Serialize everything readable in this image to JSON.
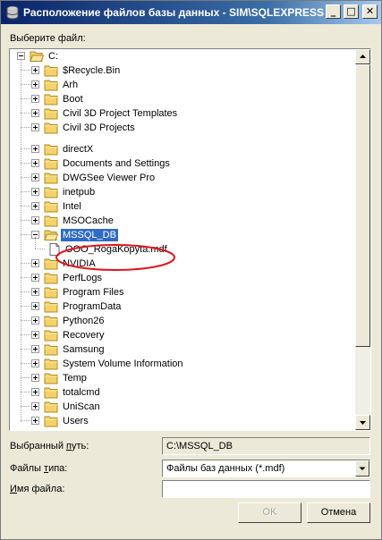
{
  "window": {
    "title": "Расположение файлов базы данных - SIM\\SQLEXPRESS",
    "buttons": {
      "minimize": "_",
      "maximize": "□",
      "close": "✕"
    }
  },
  "tree_label": "Выберите файл:",
  "tree": {
    "root": "C:",
    "items": [
      {
        "label": "$Recycle.Bin",
        "expander": "+"
      },
      {
        "label": "Arh",
        "expander": "+"
      },
      {
        "label": "Boot",
        "expander": "+"
      },
      {
        "label": "Civil 3D Project Templates",
        "expander": "+"
      },
      {
        "label": "Civil 3D Projects",
        "expander": "+"
      },
      {
        "label": "directX",
        "expander": "+"
      },
      {
        "label": "Documents and Settings",
        "expander": "+"
      },
      {
        "label": "DWGSee Viewer Pro",
        "expander": "+"
      },
      {
        "label": "inetpub",
        "expander": "+"
      },
      {
        "label": "Intel",
        "expander": "+"
      },
      {
        "label": "MSOCache",
        "expander": "+"
      },
      {
        "label": "MSSQL_DB",
        "expander": "-",
        "selected": true
      },
      {
        "label": "OOO_RogaKopyta.mdf",
        "type": "file"
      },
      {
        "label": "NVIDIA",
        "expander": "+"
      },
      {
        "label": "PerfLogs",
        "expander": "+"
      },
      {
        "label": "Program Files",
        "expander": "+"
      },
      {
        "label": "ProgramData",
        "expander": "+"
      },
      {
        "label": "Python26",
        "expander": "+"
      },
      {
        "label": "Recovery",
        "expander": "+"
      },
      {
        "label": "Samsung",
        "expander": "+"
      },
      {
        "label": "System Volume Information",
        "expander": "+"
      },
      {
        "label": "Temp",
        "expander": "+"
      },
      {
        "label": "totalcmd",
        "expander": "+"
      },
      {
        "label": "UniScan",
        "expander": "+"
      },
      {
        "label": "Users",
        "expander": "+"
      }
    ]
  },
  "selected_path": {
    "label_pre": "Выбранный ",
    "label_u": "п",
    "label_post": "уть:",
    "value": "C:\\MSSQL_DB"
  },
  "file_type": {
    "label_pre": "Файлы ",
    "label_u": "т",
    "label_post": "ипа:",
    "value": "Файлы баз данных (*.mdf)"
  },
  "file_name": {
    "label_u": "И",
    "label_post": "мя файла:",
    "value": ""
  },
  "ok_label": "OK",
  "cancel_label": "Отмена",
  "colors": {
    "selection": "#316ac5",
    "annotation": "#e0141e",
    "title_bar": "#0a246a"
  }
}
